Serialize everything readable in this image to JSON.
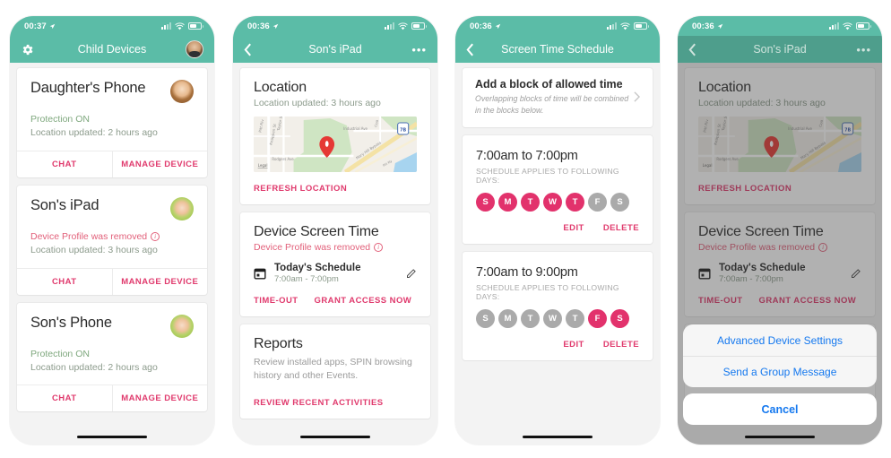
{
  "theme": {
    "teal": "#5BBCA7",
    "accent_pink": "#E03A6D",
    "day_on": "#E2326C",
    "day_off": "#AAAAAA",
    "error_red": "#E2607A",
    "ok_green": "#7FA87E",
    "ios_blue": "#1478EF",
    "page_bg": "#F3F3F3"
  },
  "screens": [
    {
      "id": "child-devices",
      "status": {
        "time": "00:37",
        "location_arrow": "location-arrow-icon",
        "signal": "signal-icon",
        "wifi": "wifi-icon",
        "battery": "battery-icon"
      },
      "nav": {
        "left_icon": "gear-icon",
        "title": "Child Devices",
        "right_icon": "parent-avatar"
      },
      "devices": [
        {
          "name": "Daughter's Phone",
          "avatar": "girl-avatar",
          "status_line": "Protection ON",
          "status_type": "ok",
          "sub_line": "Location updated: 2 hours ago",
          "actions": [
            "CHAT",
            "MANAGE DEVICE"
          ]
        },
        {
          "name": "Son's iPad",
          "avatar": "boy-avatar",
          "status_line": "Device Profile was removed",
          "status_type": "error",
          "sub_line": "Location updated: 3 hours ago",
          "actions": [
            "CHAT",
            "MANAGE DEVICE"
          ]
        },
        {
          "name": "Son's Phone",
          "avatar": "boy-avatar",
          "status_line": "Protection ON",
          "status_type": "ok",
          "sub_line": "Location updated: 2 hours ago",
          "actions": [
            "CHAT",
            "MANAGE DEVICE"
          ]
        }
      ]
    },
    {
      "id": "sons-ipad-detail",
      "status": {
        "time": "00:36"
      },
      "nav": {
        "left_icon": "back-chevron-icon",
        "title": "Son's iPad",
        "right_icon": "more-options-icon"
      },
      "location": {
        "title": "Location",
        "subtitle": "Location updated: 3 hours ago",
        "map_labels": [
          "Pitt Riv",
          "Taylor St",
          "Knappen St",
          "Rodgers Ave",
          "Industrial Ave",
          "Coa",
          "Mary Hill Bypass",
          "Legal"
        ],
        "highway_shield": "7B",
        "pin": "map-pin-icon",
        "action": "REFRESH LOCATION"
      },
      "screen_time": {
        "title": "Device Screen Time",
        "status_line": "Device Profile was removed",
        "schedule_title": "Today's Schedule",
        "schedule_time": "7:00am - 7:00pm",
        "edit_icon": "pencil-icon",
        "calendar_icon": "calendar-icon",
        "actions": [
          "TIME-OUT",
          "GRANT ACCESS NOW"
        ]
      },
      "reports": {
        "title": "Reports",
        "description": "Review installed apps, SPIN browsing history and other Events.",
        "action": "REVIEW RECENT ACTIVITIES"
      }
    },
    {
      "id": "screen-time-schedule",
      "status": {
        "time": "00:36"
      },
      "nav": {
        "left_icon": "back-chevron-icon",
        "title": "Screen Time Schedule"
      },
      "add_block": {
        "title": "Add a block of allowed time",
        "subtitle": "Overlapping blocks of time will be combined in the blocks below.",
        "chevron": "chevron-right-icon"
      },
      "day_letters": [
        "S",
        "M",
        "T",
        "W",
        "T",
        "F",
        "S"
      ],
      "blocks": [
        {
          "time_range": "7:00am to 7:00pm",
          "days_label": "SCHEDULE APPLIES TO FOLLOWING DAYS:",
          "days_active": [
            true,
            true,
            true,
            true,
            true,
            false,
            false
          ],
          "actions": [
            "EDIT",
            "DELETE"
          ]
        },
        {
          "time_range": "7:00am to 9:00pm",
          "days_label": "SCHEDULE APPLIES TO FOLLOWING DAYS:",
          "days_active": [
            false,
            false,
            false,
            false,
            false,
            true,
            true
          ],
          "actions": [
            "EDIT",
            "DELETE"
          ]
        }
      ]
    },
    {
      "id": "sons-ipad-actionsheet",
      "status": {
        "time": "00:36"
      },
      "nav": {
        "left_icon": "back-chevron-icon",
        "title": "Son's iPad",
        "right_icon": "more-options-icon"
      },
      "location": {
        "title": "Location",
        "subtitle": "Location updated: 3 hours ago",
        "action": "REFRESH LOCATION"
      },
      "screen_time": {
        "title": "Device Screen Time",
        "status_line": "Device Profile was removed",
        "schedule_title": "Today's Schedule",
        "schedule_time": "7:00am - 7:00pm",
        "actions": [
          "TIME-OUT",
          "GRANT ACCESS NOW"
        ]
      },
      "action_sheet": {
        "options": [
          "Advanced Device Settings",
          "Send a Group Message"
        ],
        "cancel": "Cancel"
      }
    }
  ]
}
